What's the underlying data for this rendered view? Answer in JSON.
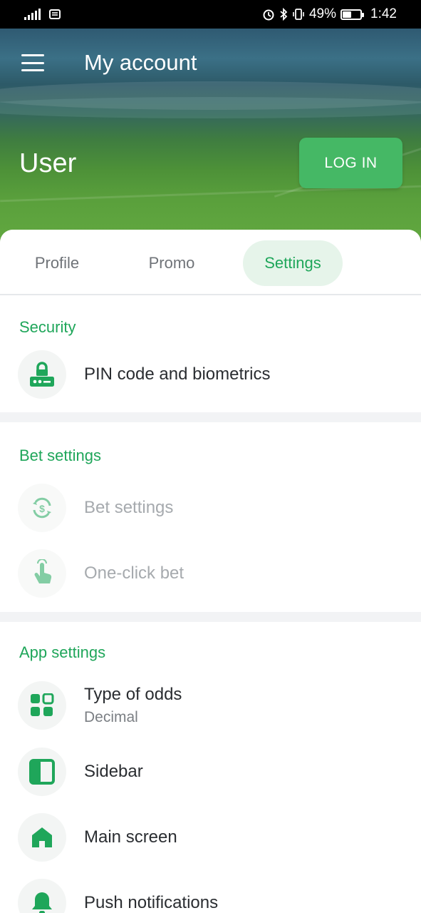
{
  "status_bar": {
    "network_icon": "signal-icon",
    "battery_percent": "49%",
    "battery_level": 0.49,
    "time": "1:42"
  },
  "header": {
    "title": "My account",
    "user_name": "User",
    "login_label": "LOG IN"
  },
  "tabs": [
    {
      "label": "Profile"
    },
    {
      "label": "Promo"
    },
    {
      "label": "Settings",
      "active": true
    }
  ],
  "sections": {
    "security": {
      "title": "Security",
      "items": [
        {
          "label": "PIN code and biometrics",
          "icon": "lock-pin-icon"
        }
      ]
    },
    "bet": {
      "title": "Bet settings",
      "items": [
        {
          "label": "Bet settings",
          "icon": "bet-refresh-icon",
          "enabled": false
        },
        {
          "label": "One-click bet",
          "icon": "tap-hand-icon",
          "enabled": false
        }
      ]
    },
    "app": {
      "title": "App settings",
      "items": [
        {
          "label": "Type of odds",
          "sub": "Decimal",
          "icon": "grid-icon"
        },
        {
          "label": "Sidebar",
          "icon": "sidebar-icon"
        },
        {
          "label": "Main screen",
          "icon": "home-icon"
        },
        {
          "label": "Push notifications",
          "icon": "bell-icon"
        }
      ]
    }
  },
  "colors": {
    "accent": "#1fa65a",
    "login_button": "#45b865",
    "active_tab_bg": "#e6f4ea"
  }
}
